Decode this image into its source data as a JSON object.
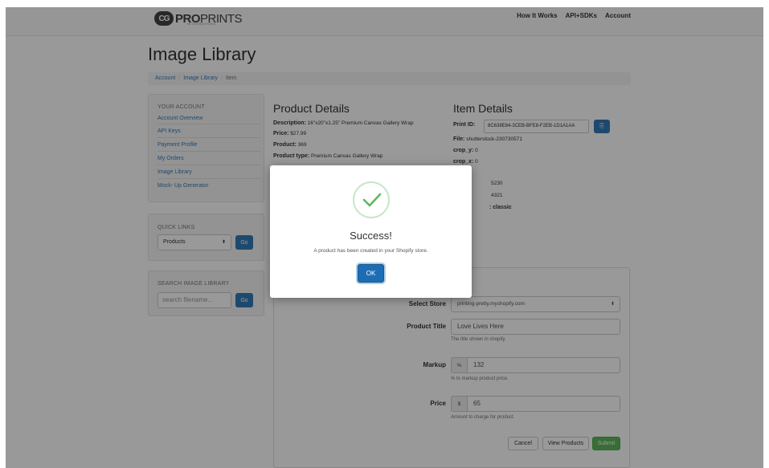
{
  "brand": {
    "badge": "CG",
    "name_bold": "PRO",
    "name_light": "PRINTS",
    "sub": "INTEGRATIONS"
  },
  "nav": {
    "links": [
      "How It Works",
      "API+SDKs",
      "Account"
    ]
  },
  "page": {
    "title": "Image Library"
  },
  "breadcrumb": {
    "items": [
      "Account",
      "Image Library",
      "Item"
    ]
  },
  "sidebar": {
    "account_title": "YOUR ACCOUNT",
    "account_items": [
      "Account Overview",
      "API Keys",
      "Payment Profile",
      "My Orders",
      "Image Library",
      "Mock- Up Generator"
    ],
    "quick_links_title": "QUICK LINKS",
    "quick_links_selected": "Products",
    "go_label": "Go",
    "search_title": "SEARCH IMAGE LIBRARY",
    "search_placeholder": "search filename..."
  },
  "product_details": {
    "heading": "Product Details",
    "description_label": "Description:",
    "description_value": "16\"x20\"x1.25\" Premium Canvas Gallery Wrap",
    "price_label": "Price:",
    "price_value": "$27.99",
    "product_label": "Product:",
    "product_value": "369",
    "type_label": "Product type:",
    "type_value": "Premium Canvas Gallery Wrap"
  },
  "item_details": {
    "heading": "Item Details",
    "print_id_label": "Print ID:",
    "print_id_value": "8C638E84-3CEB-BFE8-F2EB-1D1A1AA",
    "file_label": "File:",
    "file_value": "shutterstock-230730571",
    "crop_y_label": "crop_y:",
    "crop_y_value": "0",
    "crop_x_label": "crop_x:",
    "crop_x_value": "0",
    "partial_1": "5230",
    "partial_2": "4321",
    "partial_3": ": classic"
  },
  "form": {
    "store_label": "Select Store",
    "store_value": "printing-pretty.myshopify.com",
    "title_label": "Product Title",
    "title_value": "Love Lives Here",
    "title_help": "The title shown in shopify.",
    "markup_label": "Markup",
    "markup_addon": "%",
    "markup_value": "132",
    "markup_help": "% to markup product price.",
    "price_label": "Price",
    "price_addon": "$",
    "price_value": "65",
    "price_help": "Amount to charge for product.",
    "cancel_label": "Cancel",
    "view_label": "View Products",
    "submit_label": "Submit"
  },
  "modal": {
    "title": "Success!",
    "message": "A product has been created in your Shopify store.",
    "ok_label": "OK"
  },
  "colors": {
    "primary": "#337ab7",
    "success": "#5cb85c",
    "check": "#5cb85c"
  }
}
